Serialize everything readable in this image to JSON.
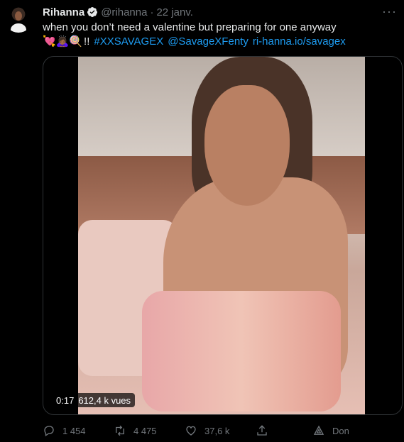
{
  "tweet": {
    "name": "Rihanna",
    "handle": "@rihanna",
    "separator": "·",
    "date": "22 janv.",
    "more": "···",
    "text_line1": "when you don’t need a valentine but preparing for one anyway",
    "text_line2_emojis": "💘🙇🏾‍♀️🍭",
    "text_line2_suffix": "!!",
    "hashtag": "#XXSAVAGEX",
    "mention": "@SavageXFenty",
    "url": "ri-hanna.io/savagex"
  },
  "video": {
    "duration": "0:17",
    "views": "612,4 k vues"
  },
  "actions": {
    "replies": "1 454",
    "retweets": "4 475",
    "likes": "37,6 k",
    "promote": "Don"
  },
  "colors": {
    "background": "#000000",
    "link": "#1d9bf0",
    "muted": "#71767b",
    "verified": "#ffffff"
  }
}
